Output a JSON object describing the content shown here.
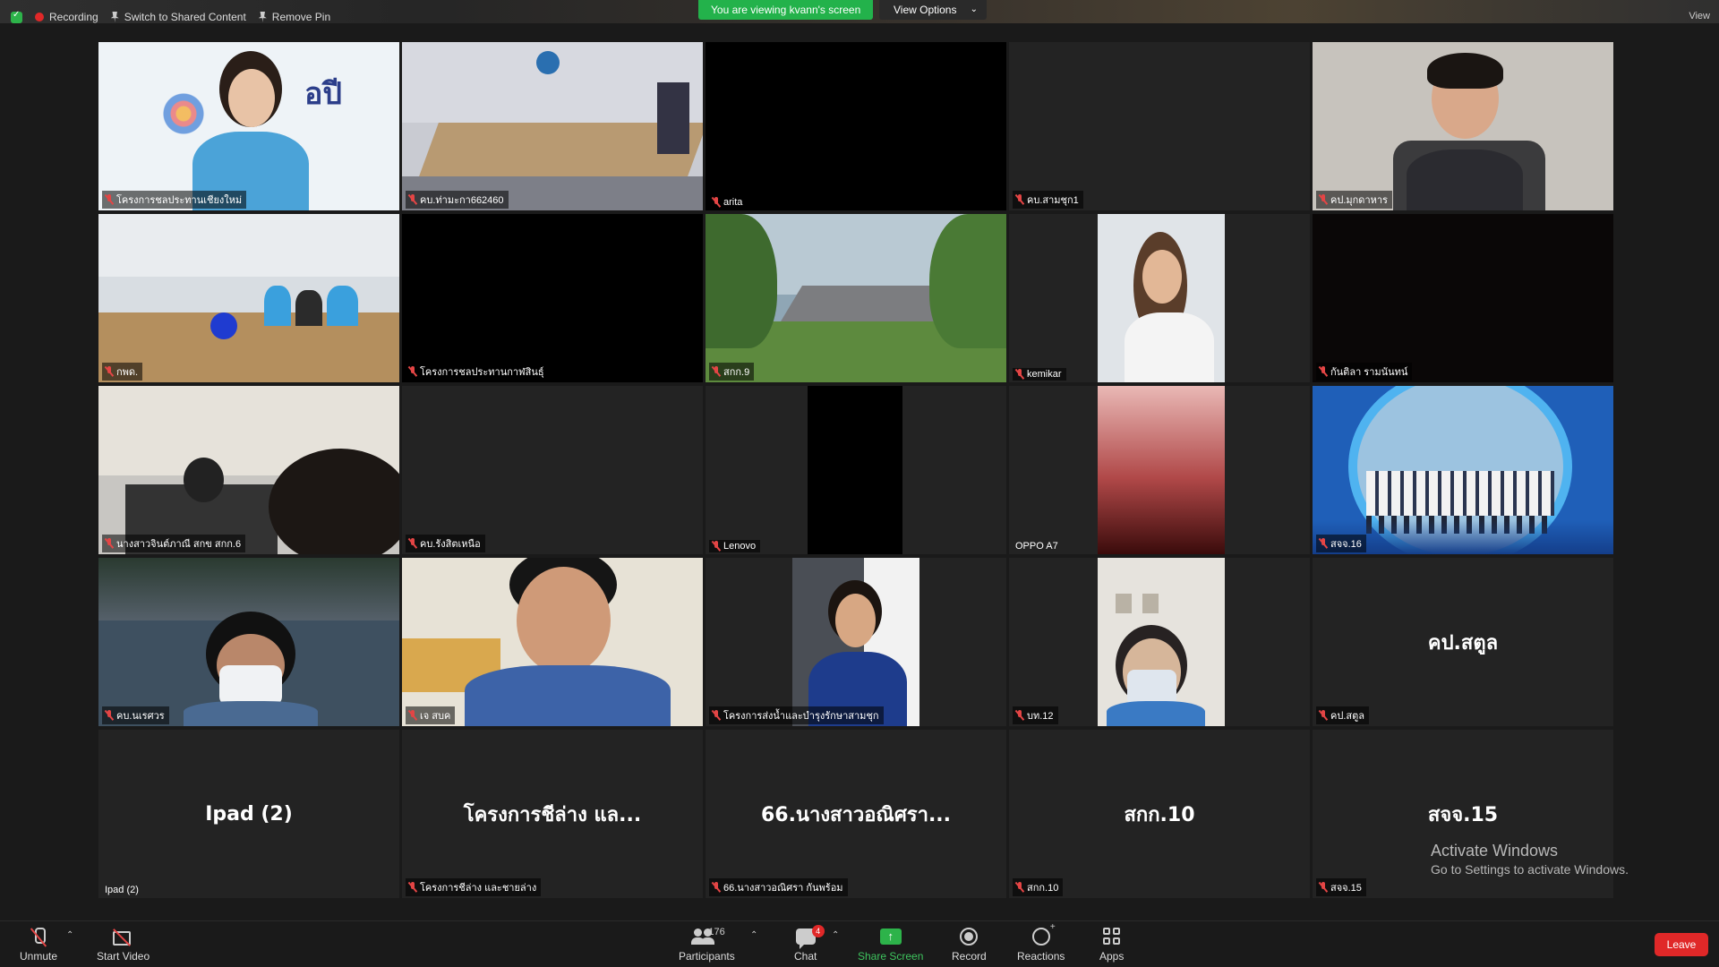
{
  "topbar": {
    "recording": "Recording",
    "switch_shared": "Switch to Shared Content",
    "remove_pin": "Remove Pin",
    "viewing": "You are viewing kvann's screen",
    "view_options": "View Options",
    "view": "View"
  },
  "tiles": [
    {
      "name": "โครงการชลประทานเชียงใหม่",
      "muted": true,
      "kind": "video"
    },
    {
      "name": "คบ.ท่ามะกา662460",
      "muted": true,
      "kind": "video"
    },
    {
      "name": "arita",
      "muted": true,
      "kind": "black"
    },
    {
      "name": "คบ.สามชุก1",
      "muted": true,
      "kind": "empty"
    },
    {
      "name": "คป.มุกดาหาร",
      "muted": true,
      "kind": "video"
    },
    {
      "name": "กพด.",
      "muted": true,
      "kind": "video"
    },
    {
      "name": "โครงการชลประทานกาฬสินธุ์",
      "muted": true,
      "kind": "black"
    },
    {
      "name": "สกก.9",
      "muted": true,
      "kind": "video"
    },
    {
      "name": "kemikar",
      "muted": true,
      "kind": "video"
    },
    {
      "name": "กันติลา รามนันทน์",
      "muted": true,
      "kind": "black"
    },
    {
      "name": "นางสาวจินต์ภาณี สกข สกก.6",
      "muted": true,
      "kind": "video"
    },
    {
      "name": "คบ.รังสิตเหนือ",
      "muted": true,
      "kind": "empty"
    },
    {
      "name": "Lenovo",
      "muted": true,
      "kind": "video"
    },
    {
      "name": "OPPO A7",
      "muted": false,
      "kind": "video"
    },
    {
      "name": "สจจ.16",
      "muted": true,
      "kind": "video"
    },
    {
      "name": "คบ.นเรศวร",
      "muted": true,
      "kind": "video"
    },
    {
      "name": "เจ สบค",
      "muted": true,
      "kind": "video"
    },
    {
      "name": "โครงการส่งน้ำและบำรุงรักษาสามชุก",
      "muted": true,
      "kind": "video"
    },
    {
      "name": "บท.12",
      "muted": true,
      "kind": "video"
    },
    {
      "name": "คป.สตูล",
      "muted": true,
      "kind": "text",
      "display": "คป.สตูล"
    },
    {
      "name": "Ipad (2)",
      "muted": false,
      "kind": "text",
      "display": "Ipad (2)"
    },
    {
      "name": "โครงการชีล่าง และชายล่าง",
      "muted": true,
      "kind": "text",
      "display": "โครงการชีล่าง แล..."
    },
    {
      "name": "66.นางสาวอณิศรา กันพร้อม",
      "muted": true,
      "kind": "text",
      "display": "66.นางสาวอณิศรา..."
    },
    {
      "name": "สกก.10",
      "muted": true,
      "kind": "text",
      "display": "สกก.10"
    },
    {
      "name": "สจจ.15",
      "muted": true,
      "kind": "text",
      "display": "สจจ.15"
    }
  ],
  "activate": {
    "title": "Activate Windows",
    "subtitle": "Go to Settings to activate Windows."
  },
  "toolbar": {
    "unmute": "Unmute",
    "start_video": "Start Video",
    "participants": "Participants",
    "participants_count": "176",
    "chat": "Chat",
    "chat_badge": "4",
    "share_screen": "Share Screen",
    "record": "Record",
    "reactions": "Reactions",
    "apps": "Apps",
    "leave": "Leave"
  }
}
